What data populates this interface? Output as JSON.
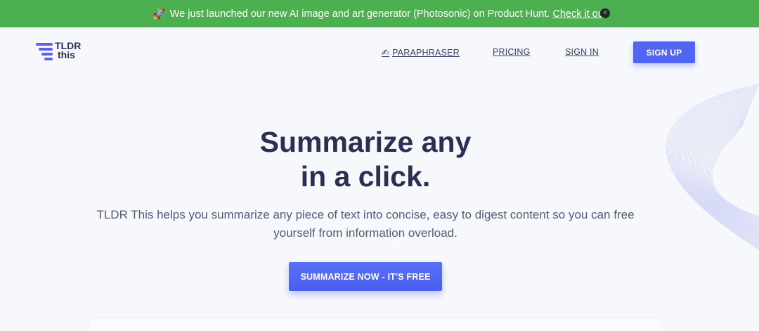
{
  "banner": {
    "icon": "rocket-icon",
    "icon_glyph": "🚀",
    "text": "We just launched our new AI image and art generator (Photosonic) on Product Hunt.",
    "link_label": "Check it out",
    "close_glyph": "×",
    "background": "#4caf50"
  },
  "header": {
    "logo": {
      "line1": "TLDR",
      "line2": "this"
    },
    "nav": {
      "paraphraser_icon": "✍",
      "paraphraser": "PARAPHRASER",
      "pricing": "PRICING",
      "sign_in": "SIGN IN"
    },
    "sign_up": "SIGN UP",
    "accent": "#5165f2"
  },
  "hero": {
    "title_line1": "Summarize any",
    "title_line2": "in a click.",
    "subtitle_line1": "TLDR This helps you summarize any piece of text into concise, easy to digest content so you can free",
    "subtitle_line2": "yourself from information overload.",
    "cta": "SUMMARIZE NOW - IT'S FREE"
  }
}
